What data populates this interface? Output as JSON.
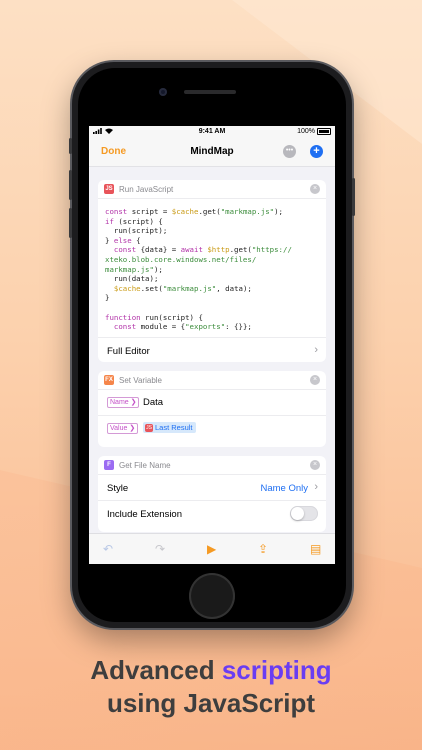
{
  "status": {
    "time": "9:41 AM",
    "battery": "100%"
  },
  "nav": {
    "done_label": "Done",
    "title": "MindMap",
    "more_glyph": "•••",
    "add_glyph": "+"
  },
  "js_card": {
    "title": "Run JavaScript",
    "badge": "JS",
    "close_glyph": "×",
    "full_editor_label": "Full Editor",
    "chevron": "›"
  },
  "setvar_card": {
    "title": "Set Variable",
    "badge": "FX",
    "close_glyph": "×",
    "name_pill": "Name ❯",
    "name_value": "Data",
    "value_pill": "Value ❯",
    "value_chip": "Last Result",
    "chip_badge": "JS"
  },
  "filename_card": {
    "title": "Get File Name",
    "badge": "F",
    "close_glyph": "×",
    "style_label": "Style",
    "style_value": "Name Only",
    "chevron": "›",
    "extension_label": "Include Extension",
    "extension_enabled": false
  },
  "toolbar": {
    "undo": "↶",
    "redo": "↷",
    "run": "▶",
    "share": "⇪",
    "doc": "▤"
  },
  "headline": {
    "line1_prefix": "Advanced",
    "line1_accent": "scripting",
    "line2": "using JavaScript"
  },
  "colors": {
    "accent_orange": "#f59a23",
    "link_blue": "#1f6ff2",
    "purple": "#6a3df2"
  }
}
